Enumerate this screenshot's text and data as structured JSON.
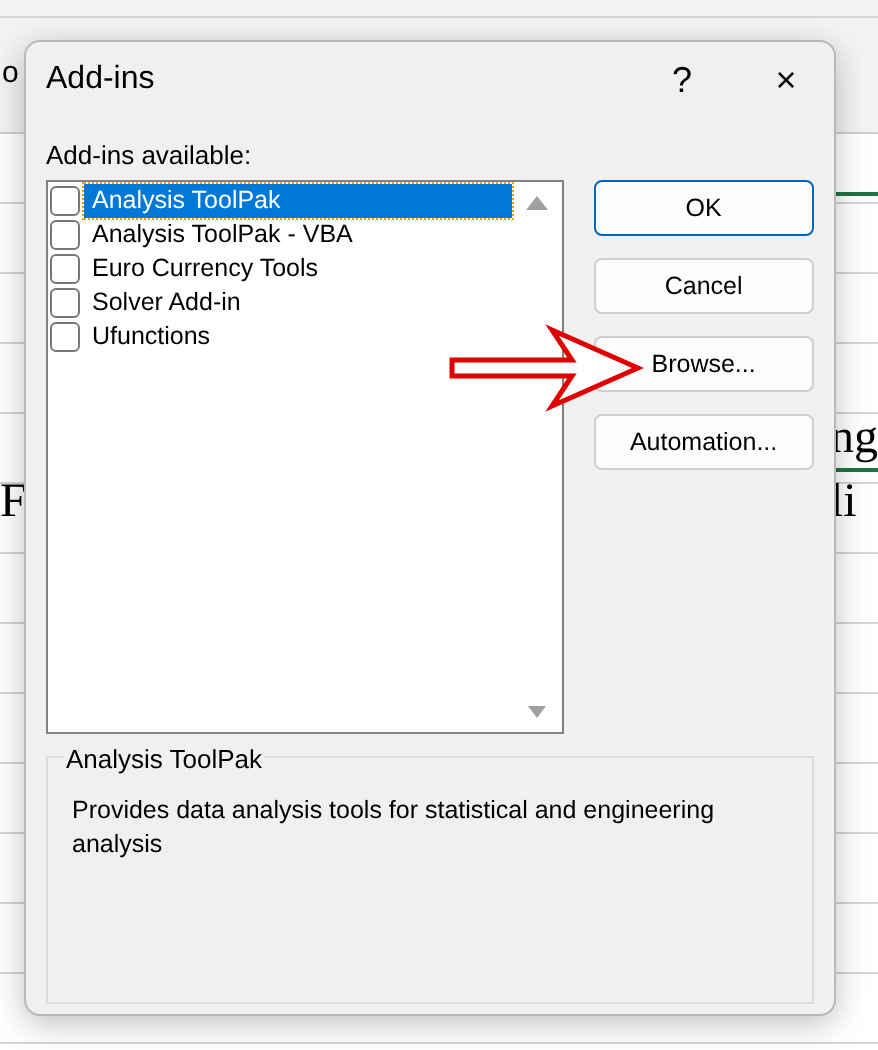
{
  "background": {
    "left_fragments": [
      "o",
      "F"
    ],
    "right_fragments": [
      "ng",
      "li"
    ]
  },
  "dialog": {
    "title": "Add-ins",
    "help": "?",
    "close": "×",
    "list_label": "Add-ins available:",
    "addins": [
      {
        "label": "Analysis ToolPak",
        "checked": false,
        "selected": true
      },
      {
        "label": "Analysis ToolPak - VBA",
        "checked": false,
        "selected": false
      },
      {
        "label": "Euro Currency Tools",
        "checked": false,
        "selected": false
      },
      {
        "label": "Solver Add-in",
        "checked": false,
        "selected": false
      },
      {
        "label": "Ufunctions",
        "checked": false,
        "selected": false
      }
    ],
    "buttons": [
      {
        "label": "OK",
        "default": true
      },
      {
        "label": "Cancel",
        "default": false
      },
      {
        "label": "Browse...",
        "default": false
      },
      {
        "label": "Automation...",
        "default": false
      }
    ],
    "description": {
      "title": "Analysis ToolPak",
      "text": "Provides data analysis tools for statistical and engineering analysis"
    }
  }
}
